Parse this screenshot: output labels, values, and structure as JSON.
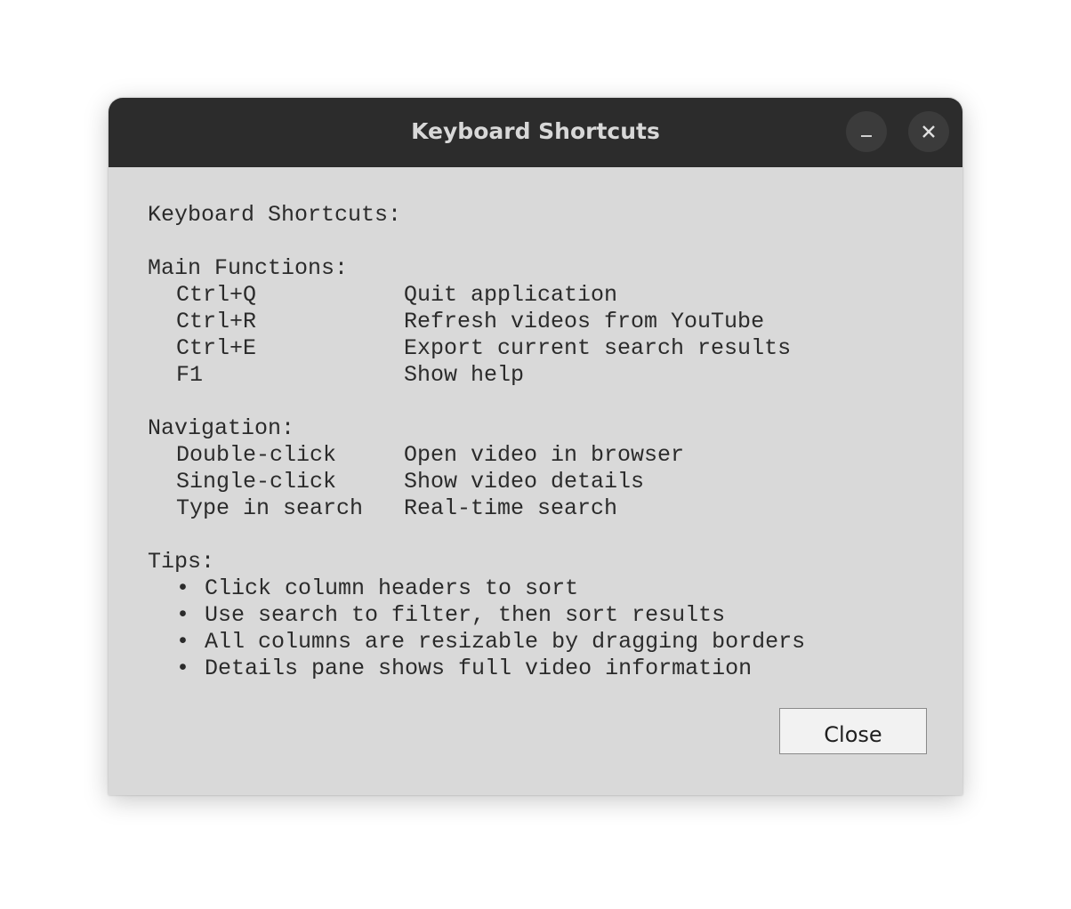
{
  "window": {
    "title": "Keyboard Shortcuts"
  },
  "content": {
    "heading": "Keyboard Shortcuts:",
    "main_functions": {
      "header": "Main Functions:",
      "items": [
        {
          "key": "Ctrl+Q",
          "desc": "Quit application"
        },
        {
          "key": "Ctrl+R",
          "desc": "Refresh videos from YouTube"
        },
        {
          "key": "Ctrl+E",
          "desc": "Export current search results"
        },
        {
          "key": "F1",
          "desc": "Show help"
        }
      ]
    },
    "navigation": {
      "header": "Navigation:",
      "items": [
        {
          "key": "Double-click",
          "desc": "Open video in browser"
        },
        {
          "key": "Single-click",
          "desc": "Show video details"
        },
        {
          "key": "Type in search",
          "desc": "Real-time search"
        }
      ]
    },
    "tips": {
      "header": "Tips:",
      "bullet": "•",
      "items": [
        "Click column headers to sort",
        "Use search to filter, then sort results",
        "All columns are resizable by dragging borders",
        "Details pane shows full video information"
      ]
    }
  },
  "buttons": {
    "close_label": "Close"
  },
  "icons": {
    "minimize": "minimize-icon",
    "close": "close-icon"
  },
  "colors": {
    "titlebar": "#2c2c2c",
    "window_bg": "#d9d9d9",
    "text": "#2b2b2b"
  }
}
